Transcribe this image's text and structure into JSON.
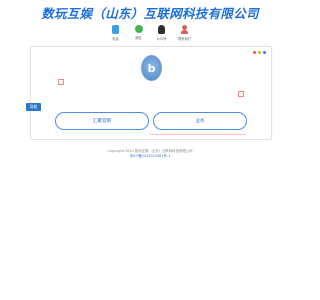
{
  "header": {
    "title": "数玩互娱（山东）互联网科技有限公司"
  },
  "contact_icons": [
    {
      "label": "电话",
      "icon": "phone-icon"
    },
    {
      "label": "微信",
      "icon": "wechat-icon"
    },
    {
      "label": "公众号",
      "icon": "qq-icon"
    },
    {
      "label": "联系我们",
      "icon": "user-icon"
    }
  ],
  "card": {
    "logo_letter": "b",
    "window_dots": [
      "#f0544f",
      "#f5b400",
      "#2f7bf2"
    ]
  },
  "nav": {
    "home_label": "导航"
  },
  "actions": {
    "left_label": "汇聚官网",
    "right_label": "业务"
  },
  "footer": {
    "copyright": "Copyright 2024 数玩互娱（山东）互联网科技有限公司",
    "icp": "鲁ICP备2023012467号-1"
  },
  "colors": {
    "accent": "#1e6fd9",
    "button_blue": "#2a77c9"
  }
}
